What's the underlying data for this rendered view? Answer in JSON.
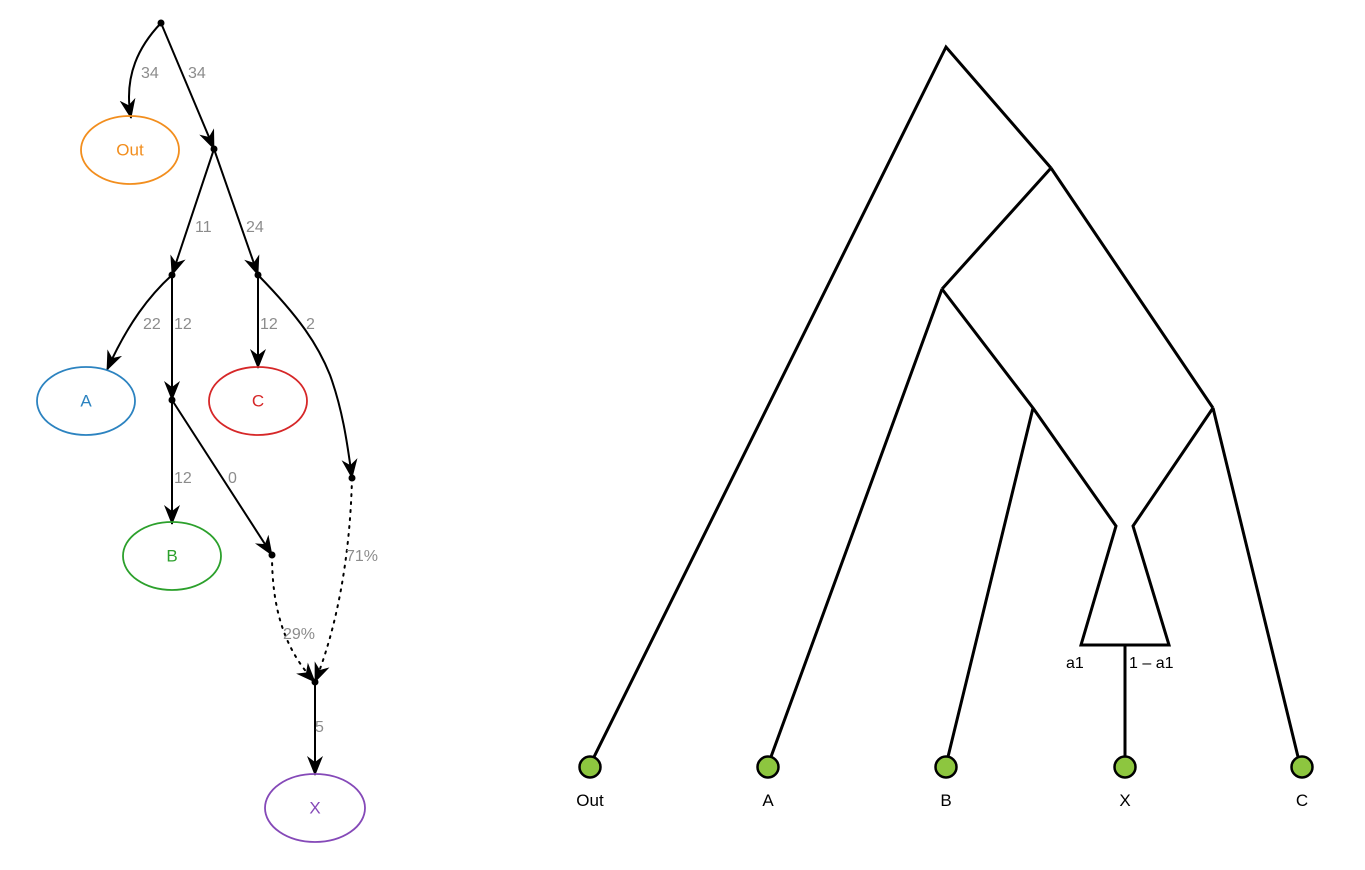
{
  "graph": {
    "nodes": {
      "out": {
        "label": "Out",
        "color": "#f28e1e"
      },
      "a": {
        "label": "A",
        "color": "#2c83c0"
      },
      "c": {
        "label": "C",
        "color": "#d62728"
      },
      "b": {
        "label": "B",
        "color": "#2ca02c"
      },
      "x": {
        "label": "X",
        "color": "#8549b8"
      }
    },
    "edge_labels": {
      "root_out": "34",
      "root_n1": "34",
      "n1_n2": "11",
      "n1_n3": "24",
      "n2_a": "22",
      "n2_n4": "12",
      "n3_c": "12",
      "n3_n6": "2",
      "n4_b": "12",
      "n4_n5": "0",
      "n6_n7": "71%",
      "n5_n7": "29%",
      "n7_x": "5"
    },
    "edge_label_color": "#8c8c8c"
  },
  "tree": {
    "leaves": [
      "Out",
      "A",
      "B",
      "X",
      "C"
    ],
    "admixture": {
      "left": "a1",
      "right": "1 – a1"
    },
    "leaf_color": "#8dc63f"
  }
}
